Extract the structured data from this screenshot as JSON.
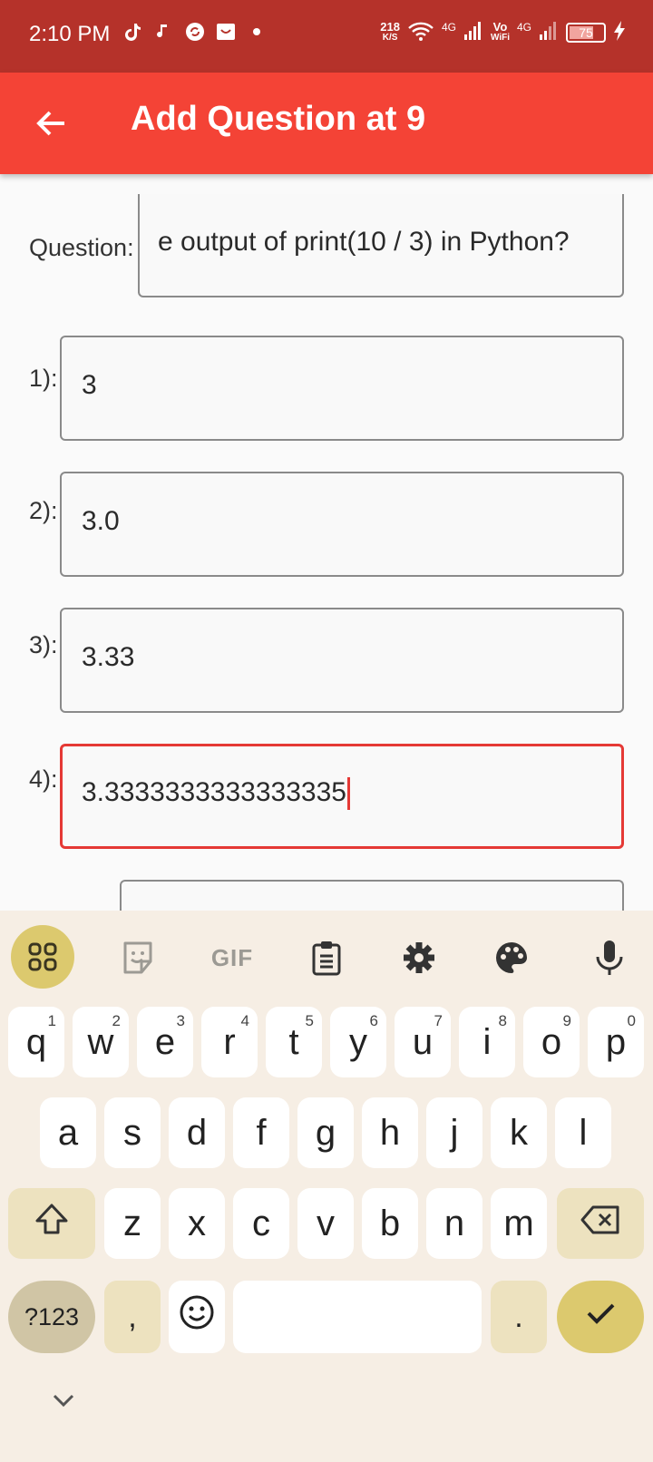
{
  "status_bar": {
    "time": "2:10 PM",
    "net_speed_top": "218",
    "net_speed_bottom": "K/S",
    "net1": "4G",
    "volte_top": "Vo",
    "volte_bottom": "WiFi",
    "net2": "4G",
    "battery": "75"
  },
  "app_bar": {
    "title": "Add Question at 9"
  },
  "form": {
    "question": {
      "label": "Question:",
      "value": "e output of print(10 / 3) in Python?"
    },
    "options": [
      {
        "label": "1):",
        "value": "3"
      },
      {
        "label": "2):",
        "value": "3.0"
      },
      {
        "label": "3):",
        "value": "3.33"
      },
      {
        "label": "4):",
        "value": "3.3333333333333335"
      }
    ]
  },
  "keyboard": {
    "toolbar": [
      "apps-grid-icon",
      "sticker-icon",
      "gif-icon",
      "clipboard-icon",
      "settings-icon",
      "palette-icon",
      "microphone-icon"
    ],
    "gif_label": "GIF",
    "row1": [
      {
        "k": "q",
        "h": "1"
      },
      {
        "k": "w",
        "h": "2"
      },
      {
        "k": "e",
        "h": "3"
      },
      {
        "k": "r",
        "h": "4"
      },
      {
        "k": "t",
        "h": "5"
      },
      {
        "k": "y",
        "h": "6"
      },
      {
        "k": "u",
        "h": "7"
      },
      {
        "k": "i",
        "h": "8"
      },
      {
        "k": "o",
        "h": "9"
      },
      {
        "k": "p",
        "h": "0"
      }
    ],
    "row2": [
      "a",
      "s",
      "d",
      "f",
      "g",
      "h",
      "j",
      "k",
      "l"
    ],
    "row3": [
      "z",
      "x",
      "c",
      "v",
      "b",
      "n",
      "m"
    ],
    "symbols_label": "?123",
    "comma": ",",
    "period": "."
  },
  "colors": {
    "status_bar": "#b5322a",
    "app_bar": "#f44336",
    "focus": "#e53935",
    "keyboard_bg": "#f6eee4",
    "accent_key": "#dcc96e"
  }
}
